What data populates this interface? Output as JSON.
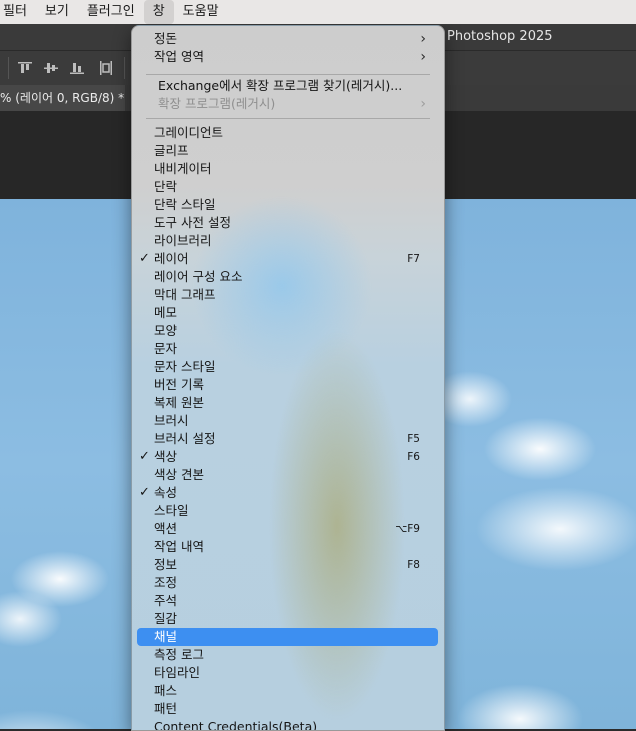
{
  "menubar": {
    "items": [
      "필터",
      "보기",
      "플러그인",
      "창",
      "도움말"
    ],
    "active_index": 3
  },
  "app": {
    "title": "Photoshop 2025",
    "document_tab": "% (레이어 0, RGB/8) *"
  },
  "colors": {
    "highlight": "#3d8ff1",
    "check_color": "#151515"
  },
  "window_menu": {
    "top_items": [
      {
        "label": "정돈",
        "submenu": true
      },
      {
        "label": "작업 영역",
        "submenu": true
      }
    ],
    "extension_items": [
      {
        "label": "Exchange에서 확장 프로그램 찾기(레거시)...",
        "enabled": true
      },
      {
        "label": "확장 프로그램(레거시)",
        "enabled": false,
        "submenu": true
      }
    ],
    "panel_items": [
      {
        "label": "그레이디언트",
        "checked": false,
        "shortcut": ""
      },
      {
        "label": "글리프",
        "checked": false,
        "shortcut": ""
      },
      {
        "label": "내비게이터",
        "checked": false,
        "shortcut": ""
      },
      {
        "label": "단락",
        "checked": false,
        "shortcut": ""
      },
      {
        "label": "단락 스타일",
        "checked": false,
        "shortcut": ""
      },
      {
        "label": "도구 사전 설정",
        "checked": false,
        "shortcut": ""
      },
      {
        "label": "라이브러리",
        "checked": false,
        "shortcut": ""
      },
      {
        "label": "레이어",
        "checked": true,
        "shortcut": "F7"
      },
      {
        "label": "레이어 구성 요소",
        "checked": false,
        "shortcut": ""
      },
      {
        "label": "막대 그래프",
        "checked": false,
        "shortcut": ""
      },
      {
        "label": "메모",
        "checked": false,
        "shortcut": ""
      },
      {
        "label": "모양",
        "checked": false,
        "shortcut": ""
      },
      {
        "label": "문자",
        "checked": false,
        "shortcut": ""
      },
      {
        "label": "문자 스타일",
        "checked": false,
        "shortcut": ""
      },
      {
        "label": "버전 기록",
        "checked": false,
        "shortcut": ""
      },
      {
        "label": "복제 원본",
        "checked": false,
        "shortcut": ""
      },
      {
        "label": "브러시",
        "checked": false,
        "shortcut": ""
      },
      {
        "label": "브러시 설정",
        "checked": false,
        "shortcut": "F5"
      },
      {
        "label": "색상",
        "checked": true,
        "shortcut": "F6"
      },
      {
        "label": "색상 견본",
        "checked": false,
        "shortcut": ""
      },
      {
        "label": "속성",
        "checked": true,
        "shortcut": ""
      },
      {
        "label": "스타일",
        "checked": false,
        "shortcut": ""
      },
      {
        "label": "액션",
        "checked": false,
        "shortcut": "⌥F9"
      },
      {
        "label": "작업 내역",
        "checked": false,
        "shortcut": ""
      },
      {
        "label": "정보",
        "checked": false,
        "shortcut": "F8"
      },
      {
        "label": "조정",
        "checked": false,
        "shortcut": ""
      },
      {
        "label": "주석",
        "checked": false,
        "shortcut": ""
      },
      {
        "label": "질감",
        "checked": false,
        "shortcut": ""
      },
      {
        "label": "채널",
        "checked": false,
        "shortcut": "",
        "highlighted": true
      },
      {
        "label": "측정 로그",
        "checked": false,
        "shortcut": ""
      },
      {
        "label": "타임라인",
        "checked": false,
        "shortcut": ""
      },
      {
        "label": "패스",
        "checked": false,
        "shortcut": ""
      },
      {
        "label": "패턴",
        "checked": false,
        "shortcut": ""
      },
      {
        "label": "Content Credentials(Beta)",
        "checked": false,
        "shortcut": ""
      }
    ],
    "check_glyph": "✓",
    "submenu_glyph": "›"
  },
  "icons": {
    "options_bar": [
      "align-top-edges-icon",
      "align-vertical-centers-icon",
      "align-bottom-edges-icon",
      "distribute-horizontal-icon"
    ]
  }
}
